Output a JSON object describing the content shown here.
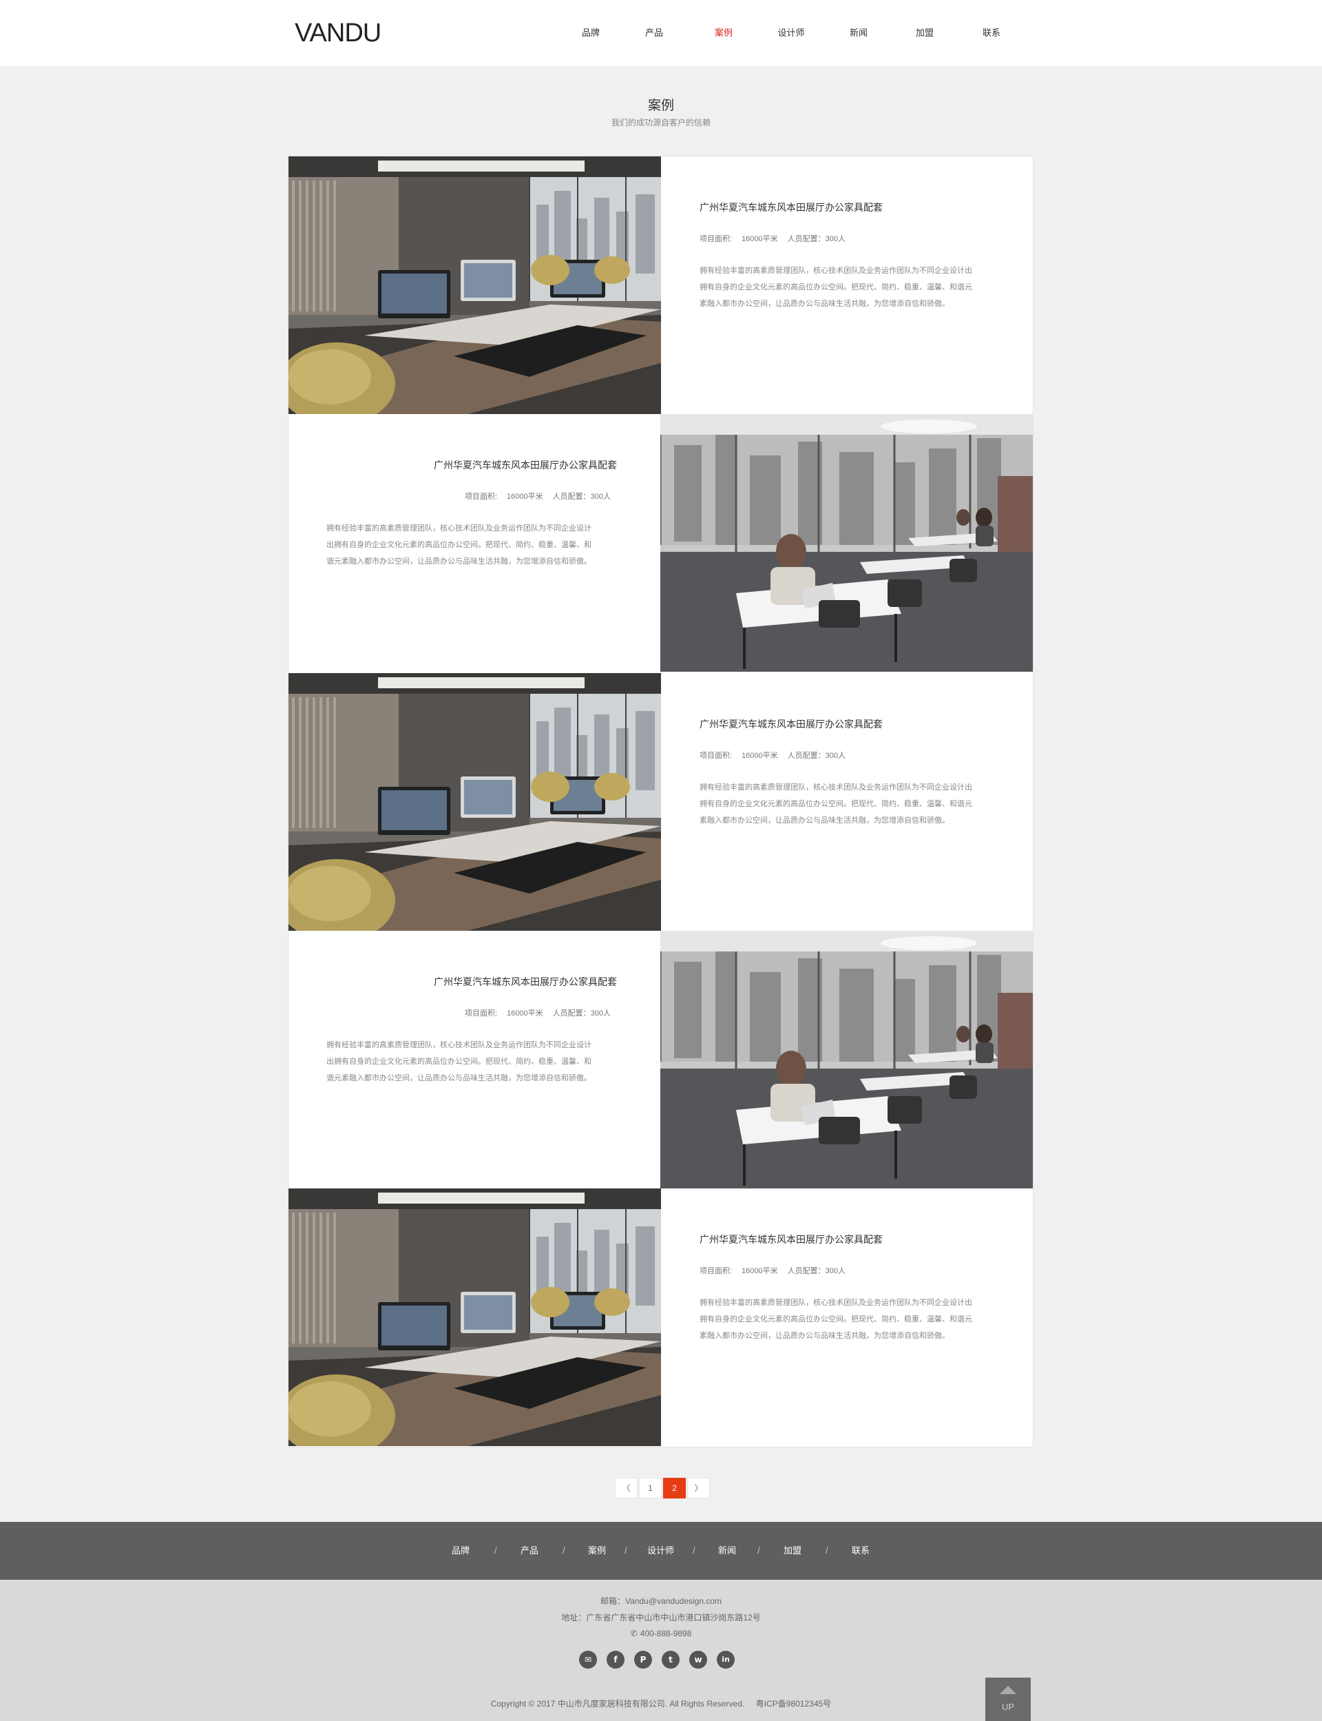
{
  "header": {
    "logo": "VANDU",
    "nav": [
      "品牌",
      "产品",
      "案例",
      "设计师",
      "新闻",
      "加盟",
      "联系"
    ],
    "active_index": 2
  },
  "section": {
    "title": "案例",
    "subtitle": "我们的成功源自客户的信赖"
  },
  "cases": [
    {
      "image": "office-desks-photo",
      "title": "广州华夏汽车城东风本田展厅办公家具配套",
      "area_label": "项目面积:",
      "area_value": "16000平米",
      "staff": "人员配置：300人",
      "desc_lines": [
        "拥有经验丰富的高素质管理团队，核心技术团队及业务运作团队为不同企业设计出",
        "拥有自身的企业文化元素的高品位办公空间。把现代、简约、稳重、温馨、和谐元",
        "素融入都市办公空间，让品质办公与品味生活共融，为您增添自信和骄傲。"
      ]
    },
    {
      "image": "office-cafe-photo",
      "title": "广州华夏汽车城东风本田展厅办公家具配套",
      "area_label": "项目面积:",
      "area_value": "16000平米",
      "staff": "人员配置：300人",
      "desc_lines": [
        "拥有经验丰富的高素质管理团队，核心技术团队及业务运作团队为不同企业设计",
        "出拥有自身的企业文化元素的高品位办公空间。把现代、简约、稳重、温馨、和",
        "谐元素融入都市办公空间，让品质办公与品味生活共融，为您增添自信和骄傲。"
      ]
    },
    {
      "image": "office-desks-photo",
      "title": "广州华夏汽车城东风本田展厅办公家具配套",
      "area_label": "项目面积:",
      "area_value": "16000平米",
      "staff": "人员配置：300人",
      "desc_lines": [
        "拥有经验丰富的高素质管理团队，核心技术团队及业务运作团队为不同企业设计出",
        "拥有自身的企业文化元素的高品位办公空间。把现代、简约、稳重、温馨、和谐元",
        "素融入都市办公空间，让品质办公与品味生活共融，为您增添自信和骄傲。"
      ]
    },
    {
      "image": "office-cafe-photo",
      "title": "广州华夏汽车城东风本田展厅办公家具配套",
      "area_label": "项目面积:",
      "area_value": "16000平米",
      "staff": "人员配置：300人",
      "desc_lines": [
        "拥有经验丰富的高素质管理团队，核心技术团队及业务运作团队为不同企业设计",
        "出拥有自身的企业文化元素的高品位办公空间。把现代、简约、稳重、温馨、和",
        "谐元素融入都市办公空间，让品质办公与品味生活共融，为您增添自信和骄傲。"
      ]
    },
    {
      "image": "office-desks-photo",
      "title": "广州华夏汽车城东风本田展厅办公家具配套",
      "area_label": "项目面积:",
      "area_value": "16000平米",
      "staff": "人员配置：300人",
      "desc_lines": [
        "拥有经验丰富的高素质管理团队，核心技术团队及业务运作团队为不同企业设计出",
        "拥有自身的企业文化元素的高品位办公空间。把现代、简约、稳重、温馨、和谐元",
        "素融入都市办公空间，让品质办公与品味生活共融，为您增添自信和骄傲。"
      ]
    }
  ],
  "pagination": {
    "prev": "〈",
    "pages": [
      "1",
      "2"
    ],
    "current": "2",
    "next": "〉"
  },
  "footer_nav": {
    "items": [
      "品牌",
      "产品",
      "案例",
      "设计师",
      "新闻",
      "加盟",
      "联系"
    ],
    "separator": "/"
  },
  "footer_info": {
    "email": "邮箱：Vandu@vandudesign.com",
    "address": "地址：广东省广东省中山市中山市港口镇沙岗东路12号",
    "phone": "400-888-9898",
    "socials": [
      "wechat-icon",
      "facebook-icon",
      "pinterest-icon",
      "twitter-icon",
      "weibo-icon",
      "linkedin-icon"
    ],
    "copyright": "Copyright © 2017 中山市凡度家居科技有限公司. All Rights Reserved.",
    "icp": "粤ICP备98012345号",
    "up_label": "UP"
  },
  "colors": {
    "accent": "#e63c14",
    "nav_active": "#d9211c",
    "footer_nav_bg": "#5f5f5f",
    "footer_bg": "#d9d9d9",
    "page_bg": "#f0f0f0"
  }
}
